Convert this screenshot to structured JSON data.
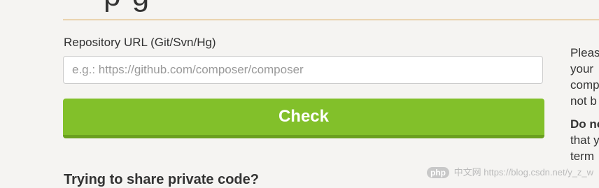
{
  "header": {
    "title_fragment": "p   g"
  },
  "form": {
    "label": "Repository URL (Git/Svn/Hg)",
    "input_placeholder": "e.g.: https://github.com/composer/composer",
    "input_value": "",
    "check_label": "Check"
  },
  "private_heading": "Trying to share private code?",
  "sidebar_lines": [
    "Pleas",
    "your",
    "comp",
    "not b"
  ],
  "sidebar_bold": "Do no",
  "sidebar_lines2": [
    "that y",
    "term"
  ],
  "watermark": {
    "logo": "php",
    "text": "中文网  https://blog.csdn.net/y_z_w"
  },
  "colors": {
    "accent_rule": "#d9a24a",
    "check_button": "#82c02a",
    "background": "#f5f4f2"
  }
}
